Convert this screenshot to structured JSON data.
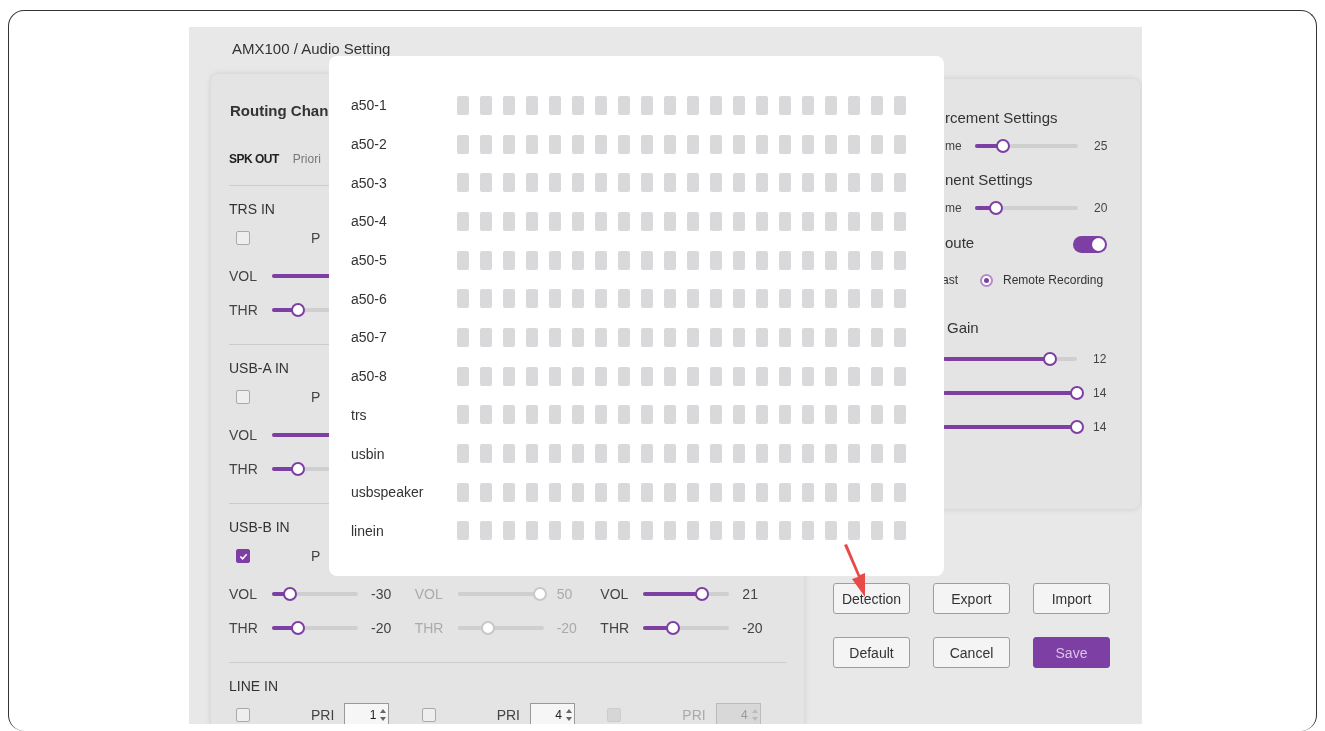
{
  "breadcrumb": "AMX100 / Audio Setting",
  "routing": {
    "title": "Routing Chan",
    "tabs": [
      {
        "label": "SPK OUT",
        "selected": true
      },
      {
        "label": "Priori",
        "selected": false
      }
    ],
    "sections": [
      {
        "title": "TRS IN",
        "columns": [
          {
            "checked": false,
            "disabled": false,
            "pri_label": "P",
            "sliders": [
              {
                "label": "VOL"
              },
              {
                "label": "THR",
                "level": 0.3
              }
            ]
          }
        ]
      },
      {
        "title": "USB-A IN",
        "columns": [
          {
            "checked": false,
            "disabled": false,
            "pri_label": "P",
            "sliders": [
              {
                "label": "VOL"
              },
              {
                "label": "THR",
                "level": 0.3
              }
            ]
          }
        ]
      },
      {
        "title": "USB-B IN",
        "columns": [
          {
            "checked": true,
            "disabled": false,
            "pri_label": "P",
            "sliders": [
              {
                "label": "VOL",
                "level": 0.21,
                "value": "-30"
              },
              {
                "label": "THR",
                "level": 0.3,
                "value": "-20"
              }
            ]
          },
          {
            "disabled": true,
            "sliders": [
              {
                "label": "VOL",
                "level": 0.96,
                "value": "50"
              },
              {
                "label": "THR",
                "level": 0.35,
                "value": "-20"
              }
            ]
          },
          {
            "disabled": false,
            "sliders": [
              {
                "label": "VOL",
                "level": 0.68,
                "value": "21"
              },
              {
                "label": "THR",
                "level": 0.34,
                "value": "-20"
              }
            ]
          }
        ]
      },
      {
        "title": "LINE IN",
        "columns": [
          {
            "checked": false,
            "disabled": false,
            "pri_label": "PRI",
            "pri_value": "1"
          },
          {
            "checked": false,
            "disabled": false,
            "pri_label": "PRI",
            "pri_value": "4"
          },
          {
            "checked": false,
            "disabled": true,
            "pri_label": "PRI",
            "pri_value": "4"
          }
        ]
      }
    ]
  },
  "output": {
    "groups": [
      {
        "title": "rcement Settings",
        "slider": {
          "label": "me",
          "level": 0.27,
          "value": "25"
        }
      },
      {
        "title": "nent Settings",
        "slider": {
          "label": "me",
          "level": 0.2,
          "value": "20"
        }
      }
    ],
    "route": {
      "title": "oute",
      "on": true,
      "options": [
        {
          "label": "ast"
        },
        {
          "label": "Remote Recording",
          "selected": true
        }
      ]
    },
    "gain": {
      "title": "Gain",
      "sliders": [
        {
          "level": 0.8,
          "value": "12"
        },
        {
          "level": 1,
          "value": "14"
        },
        {
          "level": 1,
          "value": "14"
        }
      ]
    }
  },
  "buttons": [
    {
      "label": "Detection",
      "primary": false
    },
    {
      "label": "Export",
      "primary": false
    },
    {
      "label": "Import",
      "primary": false
    },
    {
      "label": "Default",
      "primary": false
    },
    {
      "label": "Cancel",
      "primary": false
    },
    {
      "label": "Save",
      "primary": true
    }
  ],
  "detection": {
    "channels": [
      {
        "name": "a50-1"
      },
      {
        "name": "a50-2"
      },
      {
        "name": "a50-3"
      },
      {
        "name": "a50-4"
      },
      {
        "name": "a50-5"
      },
      {
        "name": "a50-6"
      },
      {
        "name": "a50-7"
      },
      {
        "name": "a50-8"
      },
      {
        "name": "trs"
      },
      {
        "name": "usbin"
      },
      {
        "name": "usbspeaker"
      },
      {
        "name": "linein"
      }
    ]
  }
}
